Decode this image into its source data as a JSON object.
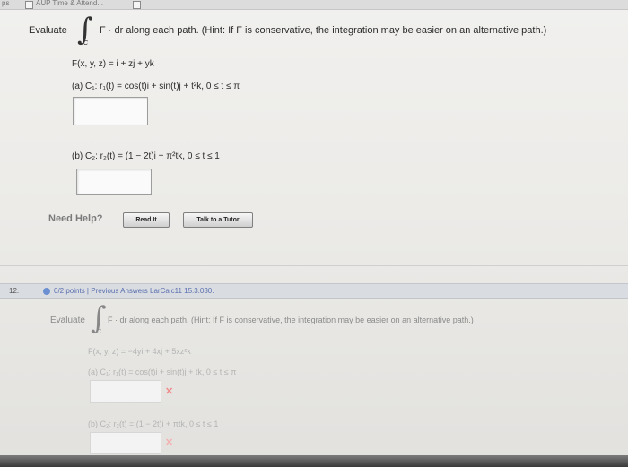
{
  "top_bar": {
    "left_fragment": "ps",
    "tab_label": "AUP Time & Attend..."
  },
  "q1": {
    "evaluate": "Evaluate",
    "integrand": "F · dr along each path. (Hint: If F is conservative, the integration may be easier on an alternative path.)",
    "integral_sub": "C",
    "field": "F(x, y, z) = i + zj + yk",
    "part_a": "(a)   C₁: r₁(t) = cos(t)i + sin(t)j + t²k,   0 ≤ t ≤ π",
    "part_b": "(b)   C₂: r₂(t) = (1 − 2t)i + π²tk,   0 ≤ t ≤ 1",
    "need_help": "Need Help?",
    "read_it": "Read It",
    "talk_tutor": "Talk to a Tutor"
  },
  "q2": {
    "number": "12.",
    "header": "0/2 points  |  Previous Answers   LarCalc11 15.3.030.",
    "evaluate": "Evaluate",
    "integrand": "F · dr along each path. (Hint: If F is conservative, the integration may be easier on an alternative path.)",
    "integral_sub": "C",
    "field": "F(x, y, z) = −4yi + 4xj + 5xz²k",
    "part_a": "(a)   C₁: r₁(t) = cos(t)i + sin(t)j + tk,   0 ≤ t ≤ π",
    "part_b": "(b)   C₂: r₂(t) = (1 − 2t)i + πtk,   0 ≤ t ≤ 1",
    "wrong_mark": "✕"
  },
  "colors": {
    "points_blue": "#5a6fb0",
    "wrong_red": "#f08a8a"
  }
}
